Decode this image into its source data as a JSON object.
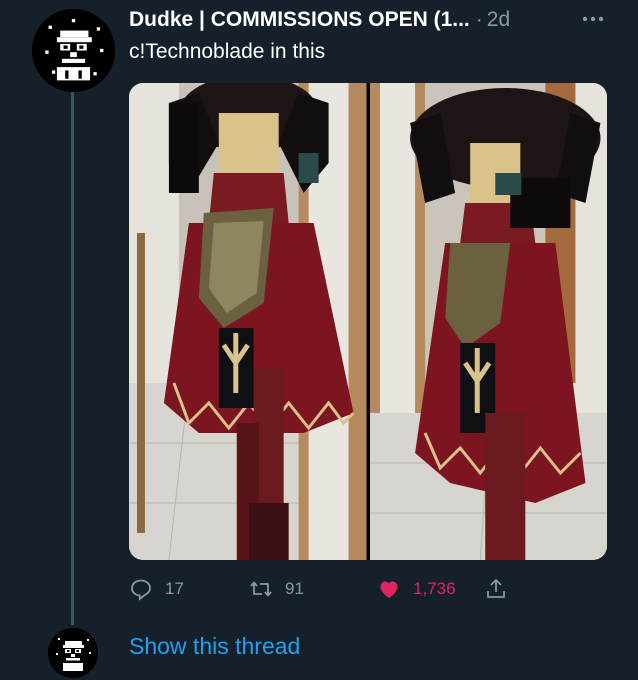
{
  "tweet": {
    "author": "Dudke | COMMISSIONS OPEN (1...",
    "time_sep": "·",
    "time": "2d",
    "text": "c!Technoblade in this",
    "replies": "17",
    "retweets": "91",
    "likes": "1,736"
  },
  "thread": {
    "show_label": "Show this thread"
  },
  "colors": {
    "background": "#15202b",
    "secondary_text": "#8899a6",
    "link": "#1da1f2",
    "like": "#e0245e"
  },
  "icons": [
    "more-icon",
    "reply-icon",
    "retweet-icon",
    "like-icon",
    "share-icon"
  ]
}
